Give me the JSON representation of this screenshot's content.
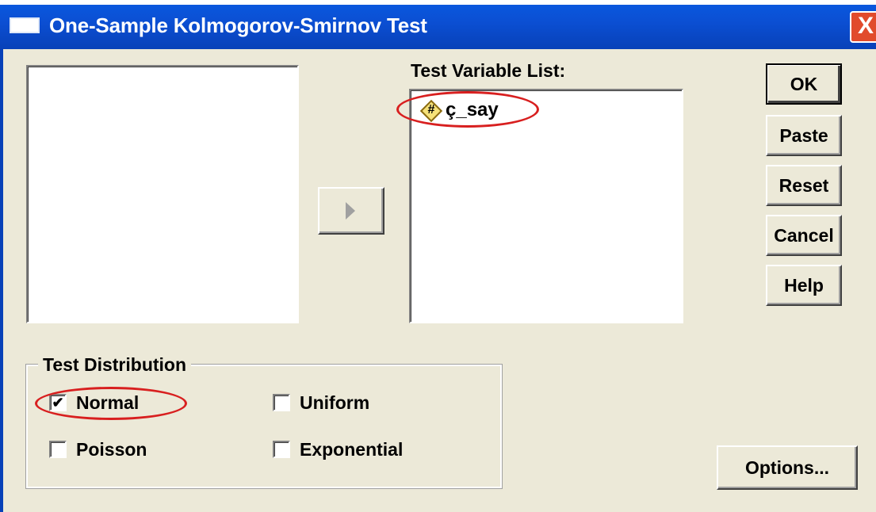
{
  "window": {
    "title": "One-Sample Kolmogorov-Smirnov Test",
    "close_glyph": "X"
  },
  "lists": {
    "test_variable_label": "Test Variable List:",
    "test_variables": [
      {
        "name": "ç_say",
        "icon": "numeric-variable-icon",
        "icon_glyph": "#"
      }
    ]
  },
  "buttons": {
    "ok": "OK",
    "paste": "Paste",
    "reset": "Reset",
    "cancel": "Cancel",
    "help": "Help",
    "options": "Options..."
  },
  "test_distribution": {
    "label": "Test Distribution",
    "options": [
      {
        "label": "Normal",
        "checked": true
      },
      {
        "label": "Uniform",
        "checked": false
      },
      {
        "label": "Poisson",
        "checked": false
      },
      {
        "label": "Exponential",
        "checked": false
      }
    ]
  },
  "annotation_color": "#d81f1f",
  "title_bar_color": "#0b4fd3"
}
